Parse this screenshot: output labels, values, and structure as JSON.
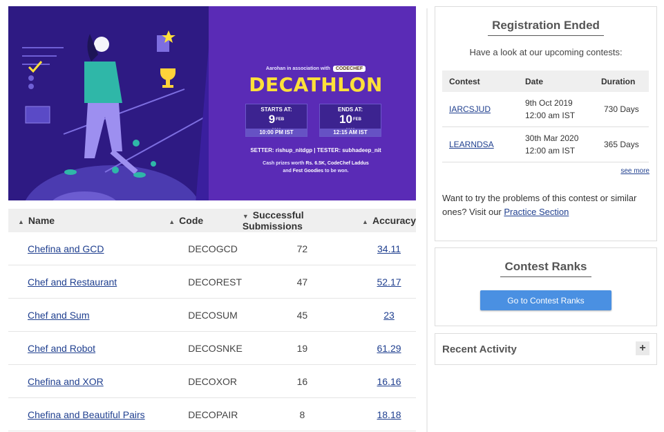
{
  "banner": {
    "association": "Aarohan in association with",
    "association_logo": "CODECHEF",
    "title": "DECATHLON",
    "starts_label": "STARTS AT:",
    "starts_day": "9",
    "starts_month": "FEB",
    "starts_year": "2020",
    "starts_time": "10:00 PM IST",
    "ends_label": "ENDS AT:",
    "ends_day": "10",
    "ends_month": "FEB",
    "ends_year": "2020",
    "ends_time": "12:15 AM IST",
    "setter_line": "SETTER: rishup_nitdgp | TESTER: subhadeep_nit",
    "prize_line1_a": "Cash prizes worth ",
    "prize_line1_b": "Rs. 6.5K, CodeChef Laddus",
    "prize_line2_a": "and ",
    "prize_line2_b": "Fest Goodies",
    "prize_line2_c": " to be won."
  },
  "problems": {
    "headers": {
      "name": "Name",
      "code": "Code",
      "successful": "Successful Submissions",
      "accuracy": "Accuracy"
    },
    "rows": [
      {
        "name": "Chefina and GCD",
        "code": "DECOGCD",
        "successful": "72",
        "accuracy": "34.11"
      },
      {
        "name": "Chef and Restaurant",
        "code": "DECOREST",
        "successful": "47",
        "accuracy": "52.17"
      },
      {
        "name": "Chef and Sum",
        "code": "DECOSUM",
        "successful": "45",
        "accuracy": "23"
      },
      {
        "name": "Chef and Robot",
        "code": "DECOSNKE",
        "successful": "19",
        "accuracy": "61.29"
      },
      {
        "name": "Chefina and XOR",
        "code": "DECOXOR",
        "successful": "16",
        "accuracy": "16.16"
      },
      {
        "name": "Chefina and Beautiful Pairs",
        "code": "DECOPAIR",
        "successful": "8",
        "accuracy": "18.18"
      }
    ]
  },
  "registration": {
    "title": "Registration Ended",
    "subtitle": "Have a look at our upcoming contests:",
    "headers": {
      "contest": "Contest",
      "date": "Date",
      "duration": "Duration"
    },
    "contests": [
      {
        "code": "IARCSJUD",
        "date_line1": "9th Oct 2019",
        "date_line2": "12:00 am IST",
        "duration": "730 Days"
      },
      {
        "code": "LEARNDSA",
        "date_line1": "30th Mar 2020",
        "date_line2": "12:00 am IST",
        "duration": "365 Days"
      }
    ],
    "see_more": "see more",
    "practice_text": "Want to try the problems of this contest or similar ones? Visit our ",
    "practice_link": "Practice Section"
  },
  "ranks": {
    "title": "Contest Ranks",
    "button": "Go to Contest Ranks"
  },
  "recent": {
    "title": "Recent Activity",
    "toggle": "+"
  },
  "colors": {
    "banner_bg": "#3a1f9e",
    "banner_title": "#ffe03a",
    "button_blue": "#4a90e2",
    "link": "#1f3f8f"
  }
}
